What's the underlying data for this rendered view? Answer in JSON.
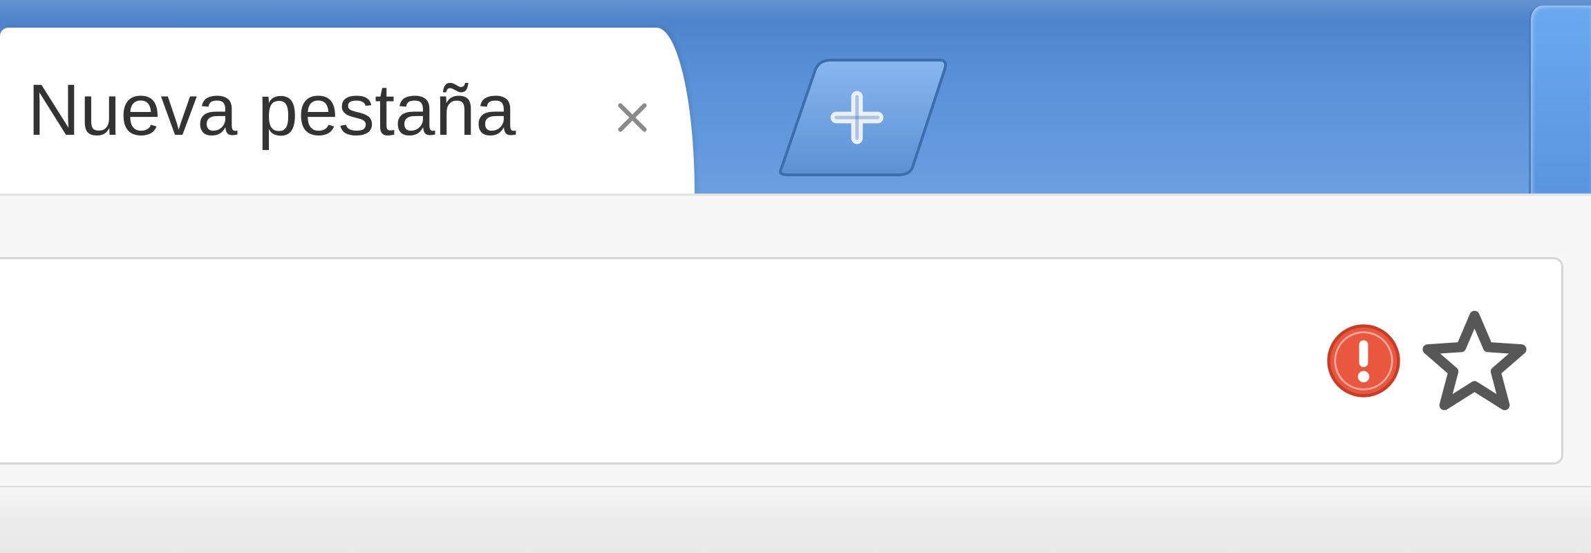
{
  "tabstrip": {
    "active_tab": {
      "title": "Nueva pestaña",
      "close_label": "x"
    },
    "new_tab_button": {
      "label": "+"
    }
  },
  "toolbar": {
    "address_bar": {
      "value": "",
      "placeholder": ""
    },
    "icons": {
      "alert": "alert-icon",
      "bookmark": "star-icon"
    }
  },
  "colors": {
    "tabstrip_gradient_top": "#4a80c8",
    "tabstrip_gradient_bottom": "#6aa0e0",
    "tab_active_bg": "#fefefe",
    "toolbar_bg": "#f7f7f7",
    "alert_bg": "#e9573f",
    "star_stroke": "#575757"
  }
}
